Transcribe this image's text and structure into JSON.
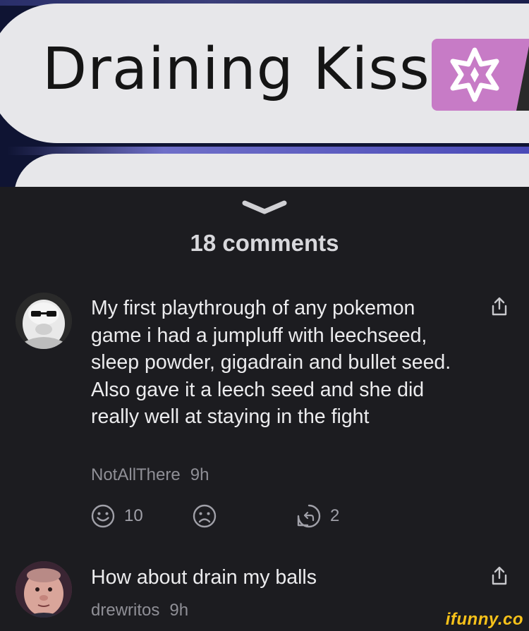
{
  "hero": {
    "move_name": "Draining Kiss",
    "type_badge_icon": "fairy-type-icon",
    "colors": {
      "badge": "#c77bc6",
      "panel": "#e7e7ea",
      "accent": "#4a4ab8"
    }
  },
  "comments_header": {
    "collapse_icon": "chevron-down-icon",
    "count_label": "18 comments"
  },
  "comments": [
    {
      "text": "My first playthrough of any pokemon game i had a jumpluff with leechseed, sleep powder, gigadrain and bullet seed. Also gave it a leech seed and she did really well at staying in the fight",
      "author": "NotAllThere",
      "time": "9h",
      "smile_count": "10",
      "reply_count": "2"
    },
    {
      "text": "How about drain my balls",
      "author": "drewritos",
      "time": "9h"
    }
  ],
  "watermark": "ifunny.co",
  "colors": {
    "background": "#1c1c20",
    "text": "#ececee",
    "muted": "#8f8f96",
    "watermark": "#f7c21a"
  }
}
